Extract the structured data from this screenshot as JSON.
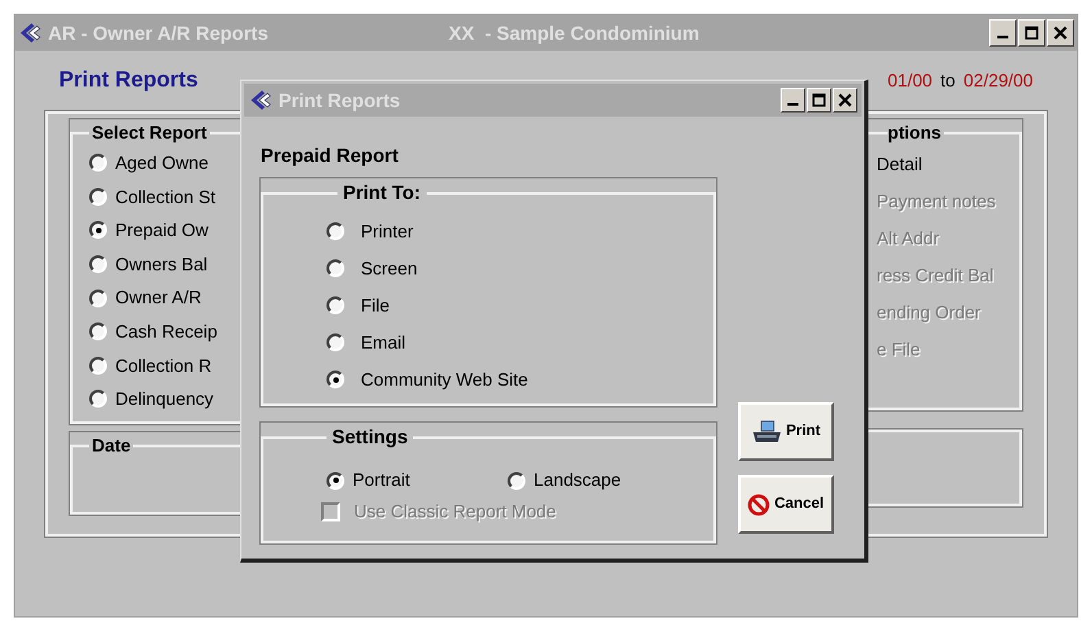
{
  "window": {
    "title": "AR - Owner A/R Reports",
    "subtitle": "XX  - Sample Condominium"
  },
  "header": {
    "title": "Print Reports",
    "date_from": "01/00",
    "date_sep": "to",
    "date_to": "02/29/00"
  },
  "select_report": {
    "label": "Select Report",
    "items": [
      {
        "label": "Aged Owne",
        "selected": false
      },
      {
        "label": "Collection St",
        "selected": false
      },
      {
        "label": "Prepaid Ow",
        "selected": true
      },
      {
        "label": "Owners Bal",
        "selected": false
      },
      {
        "label": "Owner A/R",
        "selected": false
      },
      {
        "label": "Cash Receip",
        "selected": false
      },
      {
        "label": "Collection R",
        "selected": false
      },
      {
        "label": "Delinquency",
        "selected": false
      }
    ]
  },
  "date_group": {
    "label": "Date"
  },
  "options": {
    "label": "ptions",
    "items": [
      {
        "label": "Detail",
        "disabled": false
      },
      {
        "label": "Payment notes",
        "disabled": true
      },
      {
        "label": "Alt Addr",
        "disabled": true
      },
      {
        "label": "ress Credit Bal",
        "disabled": true
      },
      {
        "label": "ending Order",
        "disabled": true
      },
      {
        "label": "e File",
        "disabled": true
      }
    ]
  },
  "dialog": {
    "title": "Print Reports",
    "heading": "Prepaid Report",
    "print_to": {
      "label": "Print To:",
      "items": [
        {
          "label": "Printer",
          "selected": false
        },
        {
          "label": "Screen",
          "selected": false
        },
        {
          "label": "File",
          "selected": false
        },
        {
          "label": "Email",
          "selected": false
        },
        {
          "label": "Community Web Site",
          "selected": true
        }
      ]
    },
    "settings": {
      "label": "Settings",
      "orientation": [
        {
          "label": "Portrait",
          "selected": true
        },
        {
          "label": "Landscape",
          "selected": false
        }
      ],
      "classic_mode": {
        "label": "Use Classic Report Mode",
        "checked": false,
        "disabled": true
      }
    },
    "buttons": [
      {
        "label": "Print",
        "kind": "print"
      },
      {
        "label": "Cancel",
        "kind": "cancel"
      }
    ]
  }
}
